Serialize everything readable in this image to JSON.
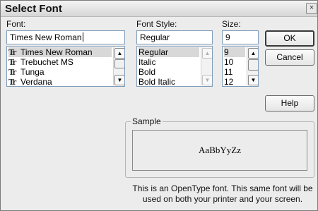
{
  "dialog": {
    "title": "Select Font",
    "close_glyph": "×"
  },
  "font": {
    "label": "Font:",
    "value": "Times New Roman",
    "items": [
      {
        "label": "Times New Roman",
        "icon": "truetype-icon",
        "selected": true
      },
      {
        "label": "Trebuchet MS",
        "icon": "truetype-icon",
        "selected": false
      },
      {
        "label": "Tunga",
        "icon": "truetype-icon",
        "selected": false
      },
      {
        "label": "Verdana",
        "icon": "truetype-icon",
        "selected": false
      }
    ],
    "icon_glyph": "Tr"
  },
  "style": {
    "label": "Font Style:",
    "value": "Regular",
    "items": [
      {
        "label": "Regular",
        "selected": true
      },
      {
        "label": "Italic",
        "selected": false
      },
      {
        "label": "Bold",
        "selected": false
      },
      {
        "label": "Bold Italic",
        "selected": false
      }
    ]
  },
  "size": {
    "label": "Size:",
    "value": "9",
    "items": [
      {
        "label": "9",
        "selected": true
      },
      {
        "label": "10",
        "selected": false
      },
      {
        "label": "11",
        "selected": false
      },
      {
        "label": "12",
        "selected": false
      }
    ]
  },
  "buttons": {
    "ok": "OK",
    "cancel": "Cancel",
    "help": "Help"
  },
  "sample": {
    "label": "Sample",
    "text": "AaBbYyZz"
  },
  "description": {
    "line1": "This is an OpenType font. This same font will be",
    "line2": "used on both your printer and your screen."
  },
  "scroll_glyphs": {
    "up": "▲",
    "down": "▼"
  }
}
